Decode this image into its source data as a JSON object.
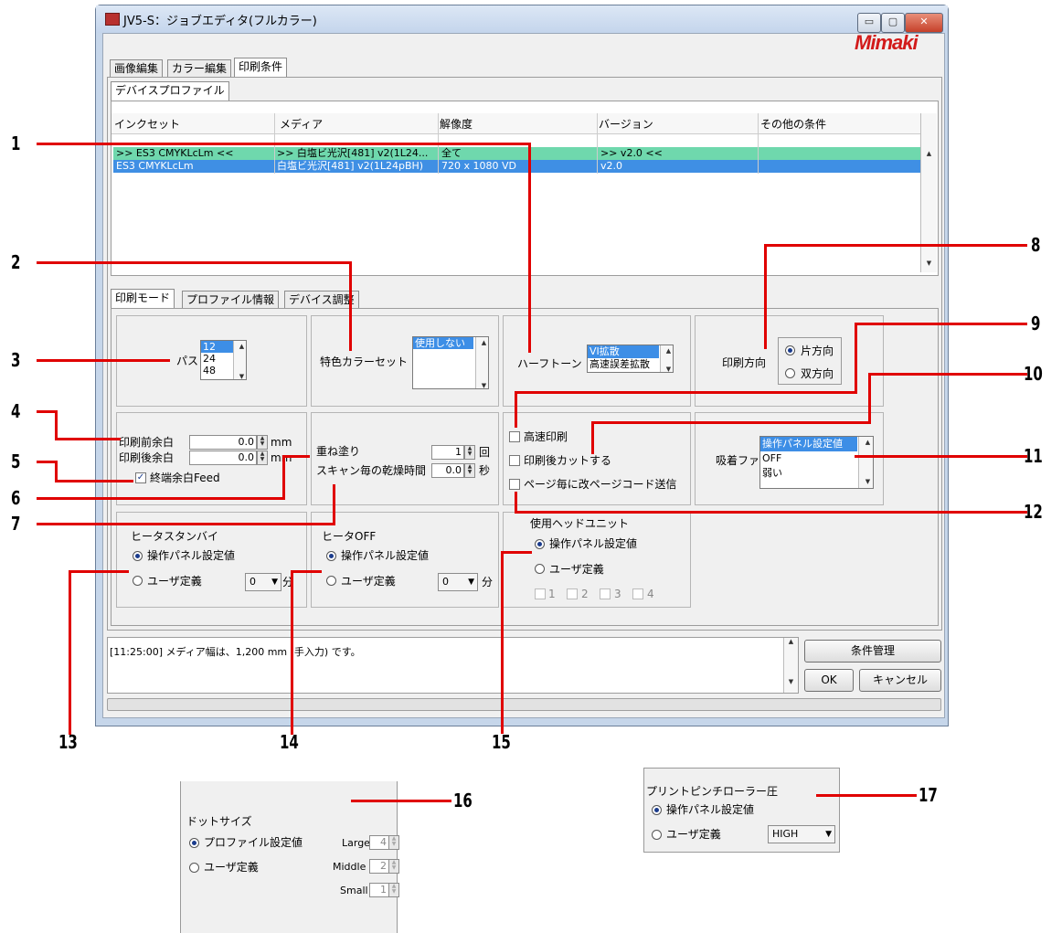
{
  "window": {
    "title": "JV5-S：ジョブエディタ(フルカラー)",
    "logo": "Mimaki",
    "controls": [
      "▭",
      "▢",
      "✕"
    ]
  },
  "main_tabs": [
    "画像編集",
    "カラー編集",
    "印刷条件"
  ],
  "device_profile": {
    "tab": "デバイスプロファイル",
    "columns": [
      "インクセット",
      "メディア",
      "解像度",
      "バージョン",
      "その他の条件"
    ],
    "rows": [
      [
        ">> ES3 CMYKLcLm <<",
        ">> 白塩ビ光沢[481] v2(1L24...",
        "全て",
        ">> v2.0 <<",
        ""
      ],
      [
        "ES3 CMYKLcLm",
        "白塩ビ光沢[481] v2(1L24pBH)",
        "720 x 1080 VD",
        "v2.0",
        ""
      ]
    ]
  },
  "sub_tabs": [
    "印刷モード",
    "プロファイル情報",
    "デバイス調整"
  ],
  "print_mode": {
    "pass": {
      "label": "パス",
      "options": [
        "12",
        "24",
        "48"
      ]
    },
    "special_color": {
      "label": "特色カラーセット",
      "options": [
        "使用しない"
      ]
    },
    "halftone": {
      "label": "ハーフトーン",
      "options": [
        "VI拡散",
        "高速誤差拡散"
      ]
    },
    "direction": {
      "label": "印刷方向",
      "options": [
        "片方向",
        "双方向"
      ]
    },
    "margin_front": {
      "label": "印刷前余白",
      "value": "0.0",
      "unit": "mm"
    },
    "margin_back": {
      "label": "印刷後余白",
      "value": "0.0",
      "unit": "mm"
    },
    "end_feed": {
      "label": "終端余白Feed"
    },
    "overprint": {
      "label": "重ね塗り",
      "value": "1",
      "unit": "回"
    },
    "dry_time": {
      "label": "スキャン毎の乾燥時間",
      "value": "0.0",
      "unit": "秒"
    },
    "high_speed": {
      "label": "高速印刷"
    },
    "cut_after": {
      "label": "印刷後カットする"
    },
    "page_code": {
      "label": "ページ毎に改ページコード送信"
    },
    "suction_fan": {
      "label": "吸着ファン",
      "options": [
        "操作パネル設定値",
        "OFF",
        "弱い"
      ]
    },
    "heater_standby": {
      "label": "ヒータスタンバイ",
      "opt1": "操作パネル設定値",
      "opt2": "ユーザ定義",
      "value": "0",
      "unit": "分"
    },
    "heater_off": {
      "label": "ヒータOFF",
      "opt1": "操作パネル設定値",
      "opt2": "ユーザ定義",
      "value": "0",
      "unit": "分"
    },
    "head_unit": {
      "label": "使用ヘッドユニット",
      "opt1": "操作パネル設定値",
      "opt2": "ユーザ定義",
      "heads": [
        "1",
        "2",
        "3",
        "4"
      ]
    }
  },
  "status": {
    "message": "[11:25:00] メディア幅は、1,200 mm (手入力) です。"
  },
  "buttons": {
    "manage": "条件管理",
    "ok": "OK",
    "cancel": "キャンセル"
  },
  "callouts": [
    "1",
    "2",
    "3",
    "4",
    "5",
    "6",
    "7",
    "8",
    "9",
    "10",
    "11",
    "12",
    "13",
    "14",
    "15",
    "16",
    "17"
  ],
  "inset_dot": {
    "title": "ドットサイズ",
    "opt1": "プロファイル設定値",
    "opt2": "ユーザ定義",
    "large_label": "Large",
    "large_value": "4",
    "middle_label": "Middle",
    "middle_value": "2",
    "small_label": "Small",
    "small_value": "1"
  },
  "inset_pinch": {
    "title": "プリントピンチローラー圧",
    "opt1": "操作パネル設定値",
    "opt2": "ユーザ定義",
    "value": "HIGH"
  }
}
